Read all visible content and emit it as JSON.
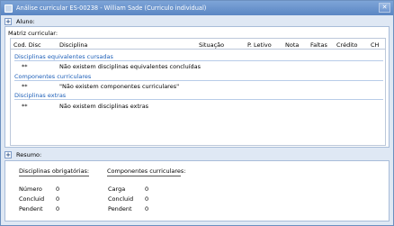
{
  "window": {
    "title": "Análise curricular ES-00238 - William Sade (Curriculo individual)",
    "close_glyph": "✕"
  },
  "aluno": {
    "toggle_glyph": "+",
    "label": "Aluno:"
  },
  "matriz": {
    "label": "Matriz curricular:",
    "columns": {
      "cod": "Cod. Disc",
      "disciplina": "Disciplina",
      "situacao": "Situação",
      "periodo": "P. Letivo",
      "nota": "Nota",
      "faltas": "Faltas",
      "credito": "Crédito",
      "ch": "CH"
    },
    "groups": [
      {
        "title": "Disciplinas equivalentes cursadas",
        "code": "**",
        "text": "Não existem disciplinas equivalentes concluídas"
      },
      {
        "title": "Componentes curriculares",
        "code": "**",
        "text": "\"Não existem componentes curriculares\""
      },
      {
        "title": "Disciplinas extras",
        "code": "**",
        "text": "Não existem disciplinas extras"
      }
    ]
  },
  "resumo": {
    "toggle_glyph": "+",
    "label": "Resumo:",
    "obrigatorias": {
      "title": "Disciplinas obrigatórias:",
      "rows": [
        {
          "key": "Número",
          "value": "0"
        },
        {
          "key": "Concluid",
          "value": "0"
        },
        {
          "key": "Pendent",
          "value": "0"
        }
      ]
    },
    "componentes": {
      "title": "Componentes curriculares:",
      "rows": [
        {
          "key": "Carga",
          "value": "0"
        },
        {
          "key": "Concluid",
          "value": "0"
        },
        {
          "key": "Pendent",
          "value": "0"
        }
      ]
    }
  }
}
